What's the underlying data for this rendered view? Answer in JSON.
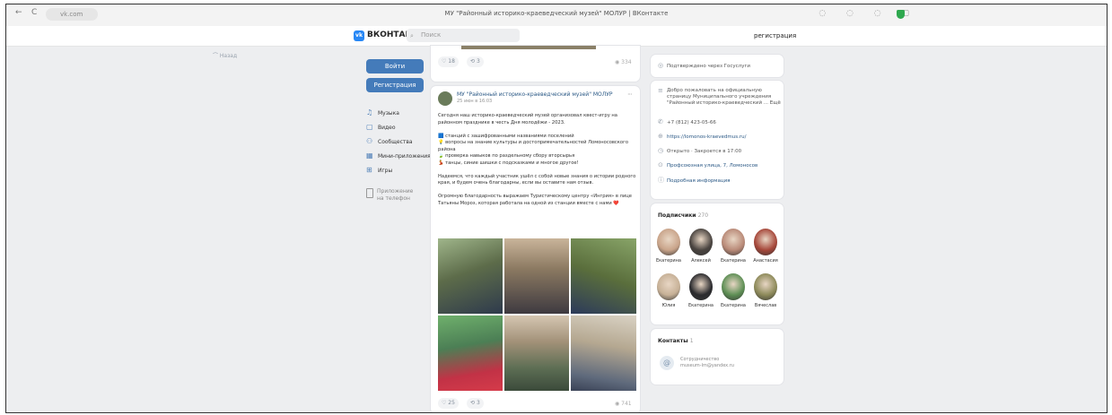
{
  "browser": {
    "back": "←",
    "reload": "C",
    "url": "vk.com",
    "tab_title": "МУ \"Районный историко-краеведческий музей\" МОЛУР | ВКонтакте"
  },
  "header": {
    "logo_mark": "vk",
    "brand": "ВКОНТАКТЕ",
    "search_placeholder": "Поиск",
    "register_link": "регистрация"
  },
  "back_link": "⌒ Назад",
  "left_nav": {
    "login_button": "Войти",
    "register_button": "Регистрация",
    "items": [
      {
        "label": "Музыка",
        "icon": "music-icon"
      },
      {
        "label": "Видео",
        "icon": "video-icon"
      },
      {
        "label": "Сообщества",
        "icon": "groups-icon"
      },
      {
        "label": "Мини-приложения",
        "icon": "apps-icon"
      },
      {
        "label": "Игры",
        "icon": "games-icon"
      }
    ],
    "app_promo": "Приложение на телефон"
  },
  "post_prev": {
    "likes": "18",
    "reposts": "3",
    "views": "334"
  },
  "post": {
    "author": "МУ \"Районный историко-краеведческий музей\" МОЛУР",
    "date": "25 июн в 16:03",
    "text_lines": [
      "Сегодня наш историко-краеведческий музей организовал квест-игру на",
      "районном празднике в честь Дня молодёжи - 2023.",
      "",
      "🟦 станций с зашифрованными названиями поселений",
      "💡 вопросы на знание культуры и достопримечательностей Ломоносовского",
      "района",
      "🍃 проверка навыков по раздельному сбору вторсырья",
      "💃 танцы, синие шишки с подсказками и многое другое!",
      "",
      "Надеемся, что каждый участник ушёл с собой новые знания о истории родного",
      "края, и будем очень благодарны, если вы оставите нам отзыв.",
      "",
      "Огромную благодарность выражаем Туристическому центру «Ингрия» в лице",
      "Татьяны Мороз, которая работала на одной из станции вместе с нами ❤️"
    ],
    "likes": "25",
    "reposts": "3",
    "views": "741"
  },
  "right": {
    "gosuslugi": "Подтверждено через Госуслуги",
    "info_items": [
      {
        "icon": "menu-icon",
        "text": "Добро пожаловать на официальную\nстраницу Муниципального учреждения\n\"Районный историко-краеведческий ... Ещё"
      },
      {
        "icon": "phone-icon",
        "text": "+7 (812) 423-05-66"
      },
      {
        "icon": "globe-icon",
        "text": "https://lomonos-kraevedmus.ru/"
      },
      {
        "icon": "clock-icon",
        "text": "Открыто · Закроется в 17:00"
      },
      {
        "icon": "location-icon",
        "text": "Профсоюзная улица, 7, Ломоносов"
      },
      {
        "icon": "info-icon",
        "text": "Подробная информация"
      }
    ],
    "subscribers_title": "Подписчики",
    "subscribers_count": "270",
    "subscribers": [
      {
        "name": "Екатерина",
        "color": "#c9a48a"
      },
      {
        "name": "Алексей",
        "color": "#4a4440"
      },
      {
        "name": "Екатерина",
        "color": "#b98a78"
      },
      {
        "name": "Анастасия",
        "color": "#a6473a"
      },
      {
        "name": "Юлия",
        "color": "#c7b197"
      },
      {
        "name": "Екатерина",
        "color": "#2b2b2e"
      },
      {
        "name": "Екатерина",
        "color": "#5e8f55"
      },
      {
        "name": "Вячеслав",
        "color": "#8d8a5a"
      }
    ],
    "contacts_title": "Контакты",
    "contacts_count": "1",
    "contact_line1": "Сотрудничество",
    "contact_line2": "museum-lm@yandex.ru"
  }
}
